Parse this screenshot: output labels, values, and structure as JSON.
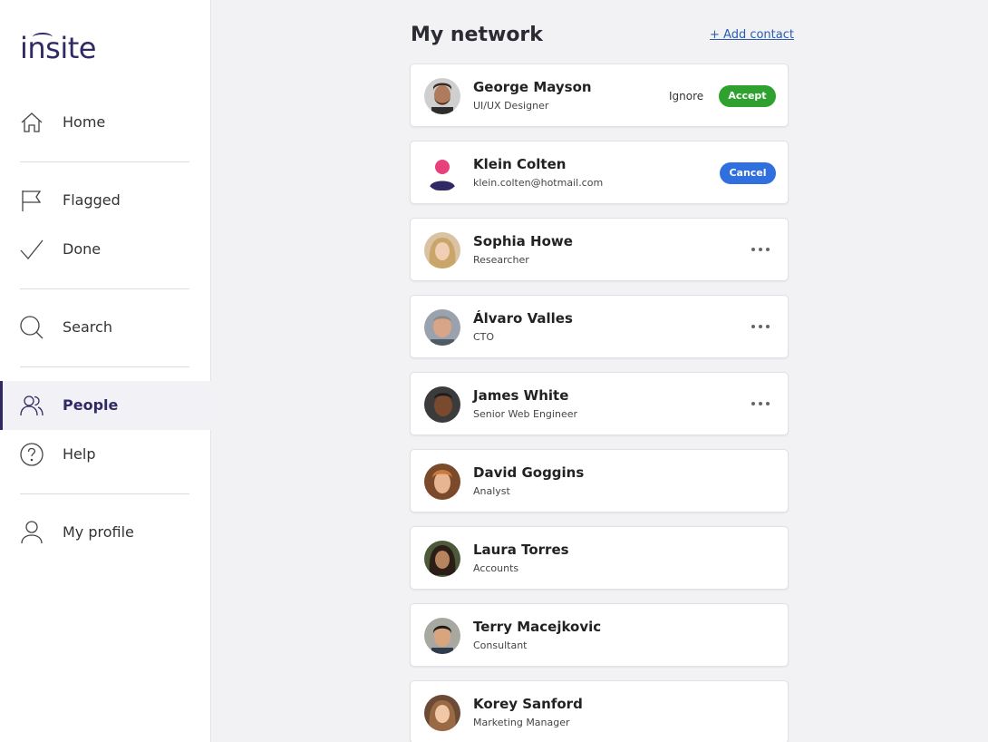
{
  "app": {
    "logo": "insite"
  },
  "sidebar": {
    "items": [
      {
        "label": "Home",
        "icon": "home-icon"
      },
      {
        "label": "Flagged",
        "icon": "flag-icon"
      },
      {
        "label": "Done",
        "icon": "check-icon"
      },
      {
        "label": "Search",
        "icon": "search-icon"
      },
      {
        "label": "People",
        "icon": "people-icon",
        "active": true
      },
      {
        "label": "Help",
        "icon": "help-icon"
      },
      {
        "label": "My profile",
        "icon": "user-icon"
      }
    ]
  },
  "main": {
    "title": "My network",
    "add_contact": "+ Add contact",
    "actions": {
      "ignore": "Ignore",
      "accept": "Accept",
      "cancel": "Cancel"
    },
    "contacts": [
      {
        "name": "George Mayson",
        "role": "UI/UX Designer",
        "status": "request"
      },
      {
        "name": "Klein Colten",
        "role": "klein.colten@hotmail.com",
        "status": "pending"
      },
      {
        "name": "Sophia Howe",
        "role": "Researcher",
        "status": "connected"
      },
      {
        "name": "Álvaro Valles",
        "role": "CTO",
        "status": "connected"
      },
      {
        "name": "James White",
        "role": "Senior Web Engineer",
        "status": "connected"
      },
      {
        "name": "David Goggins",
        "role": "Analyst",
        "status": "plain"
      },
      {
        "name": "Laura Torres",
        "role": "Accounts",
        "status": "plain"
      },
      {
        "name": "Terry Macejkovic",
        "role": "Consultant",
        "status": "plain"
      },
      {
        "name": "Korey Sanford",
        "role": "Marketing Manager",
        "status": "plain"
      }
    ]
  },
  "colors": {
    "brand": "#2f2a63",
    "accept": "#2ea12e",
    "cancel": "#2f6fde",
    "link": "#2a5db0"
  }
}
